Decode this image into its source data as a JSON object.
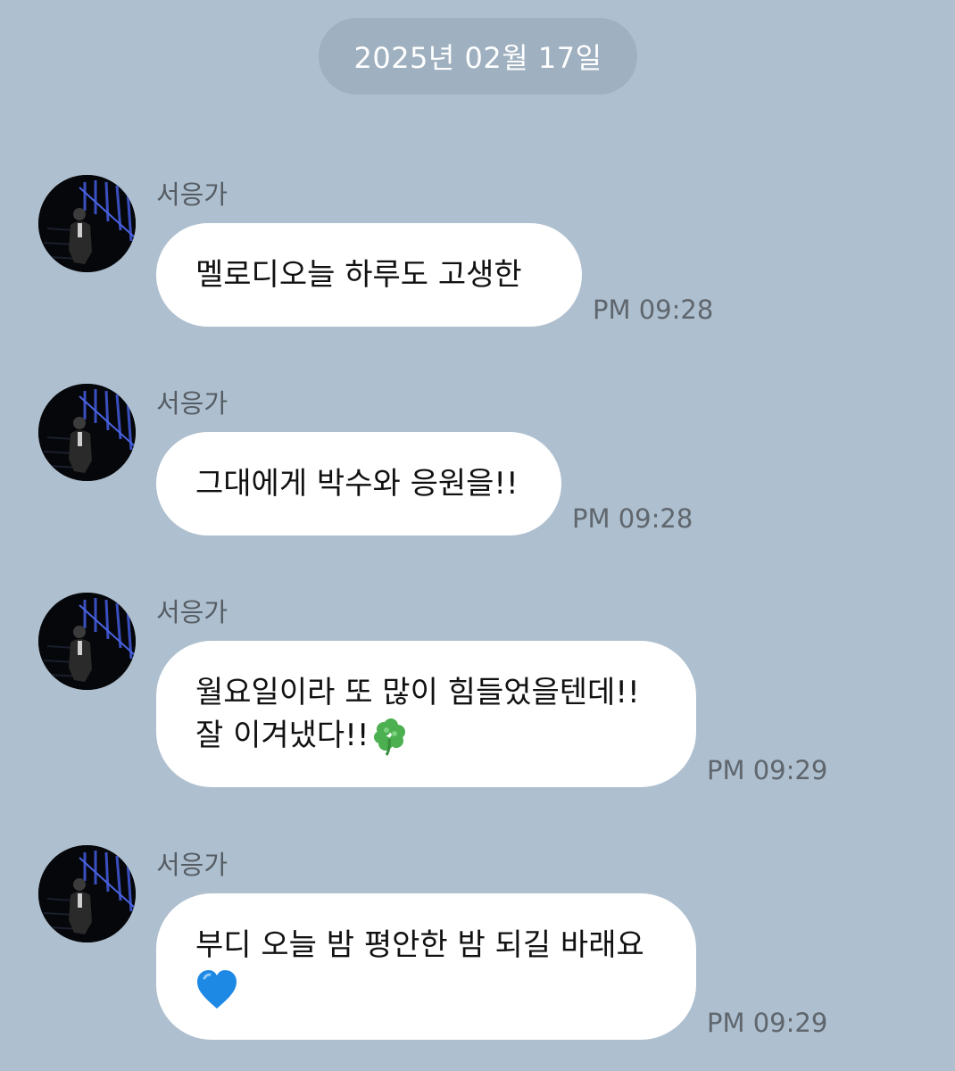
{
  "date_separator": "2025년 02월 17일",
  "messages": [
    {
      "sender": "서응가",
      "lines": [
        "멜로디오늘 하루도 고생한"
      ],
      "time": "PM 09:28"
    },
    {
      "sender": "서응가",
      "lines": [
        "그대에게 박수와 응원을!!"
      ],
      "time": "PM 09:28"
    },
    {
      "sender": "서응가",
      "lines": [
        "월요일이라 또 많이 힘들었을텐데!!",
        "잘 이겨냈다!!"
      ],
      "emoji": "four-leaf-clover-icon",
      "time": "PM 09:29"
    },
    {
      "sender": "서응가",
      "lines": [
        "부디 오늘 밤 평안한 밤 되길 바래요"
      ],
      "emoji": "blue-heart-icon",
      "time": "PM 09:29"
    }
  ],
  "colors": {
    "background": "#aebfcf",
    "date_pill": "#9fb0c0",
    "bubble": "#ffffff",
    "heart": "#1e88e5",
    "clover": "#4caf50"
  }
}
